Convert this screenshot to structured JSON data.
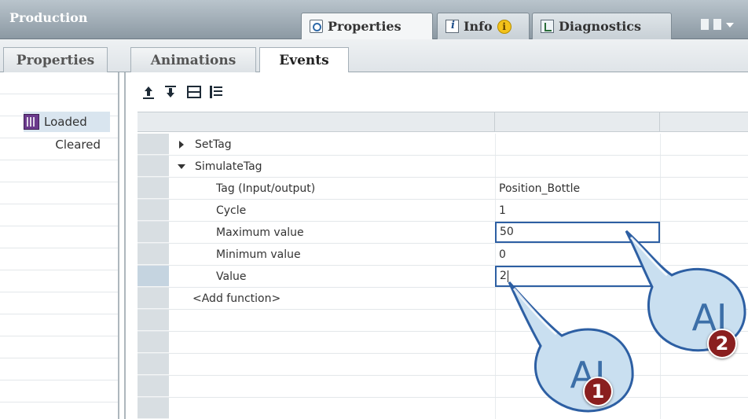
{
  "titlebar": {
    "title": "Production",
    "tabs": [
      {
        "label": "Properties",
        "icon": "magnifier-icon",
        "active": true
      },
      {
        "label": "Info",
        "icon": "info-icon",
        "badge": "i"
      },
      {
        "label": "Diagnostics",
        "icon": "diagnostics-icon"
      }
    ]
  },
  "subtabs": [
    "Properties",
    "Animations",
    "Events"
  ],
  "events": [
    "Loaded",
    "Cleared"
  ],
  "grid": {
    "rows": [
      {
        "name": "SetTag",
        "type": "collapsed"
      },
      {
        "name": "SimulateTag",
        "type": "expanded"
      },
      {
        "name": "Tag (Input/output)",
        "value": "Position_Bottle"
      },
      {
        "name": "Cycle",
        "value": "1"
      },
      {
        "name": "Maximum value",
        "value": "50"
      },
      {
        "name": "Minimum value",
        "value": "0"
      },
      {
        "name": "Value",
        "value": "2"
      },
      {
        "name": "<Add function>"
      }
    ]
  },
  "callouts": [
    {
      "badge": "1",
      "glyph": "AI"
    },
    {
      "badge": "2",
      "glyph": "AI"
    }
  ],
  "colors": {
    "accent": "#2d5fa3",
    "badge": "#8a1f1f",
    "selection": "#d9e5ef"
  }
}
